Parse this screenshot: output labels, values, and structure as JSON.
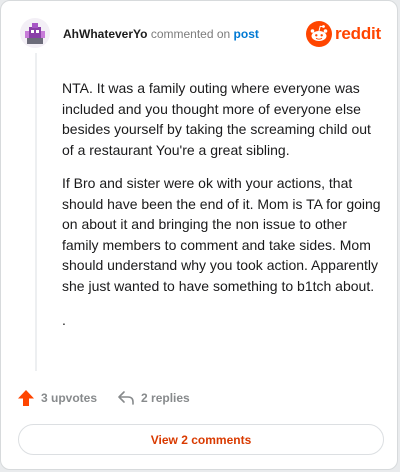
{
  "comment": {
    "username": "AhWhateverYo",
    "action_text": "commented on",
    "post_link": "post",
    "paragraphs": [
      "NTA. It was a family outing where everyone was included and you thought more of everyone else besides yourself by taking the screaming child out of a restaurant You're a great sibling.",
      "If Bro and sister were ok with your actions, that should have been the end of it. Mom is TA for going on about it and bringing the non issue to other family members to comment and take sides. Mom should understand why you took action. Apparently she just wanted to have something to b1tch about.",
      "."
    ]
  },
  "brand": {
    "logo_text": "reddit",
    "color": "#ff4500"
  },
  "actions": {
    "upvotes": "3 upvotes",
    "replies": "2 replies"
  },
  "footer": {
    "view_comments": "View 2 comments"
  },
  "icons": {
    "avatar": "avatar-icon",
    "logo": "reddit-alien-icon",
    "upvote": "upvote-arrow-icon",
    "reply": "reply-arrow-icon"
  }
}
